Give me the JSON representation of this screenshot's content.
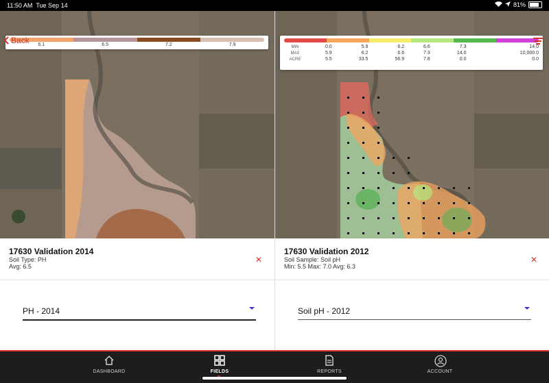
{
  "status": {
    "time": "11:50 AM",
    "date": "Tue Sep 14",
    "battery": "81%",
    "battery_level": 0.81
  },
  "nav": {
    "back_label": "Back"
  },
  "left": {
    "legend": {
      "colors": [
        "#f3a26a",
        "#b5949b",
        "#8a4a22",
        "#d7c0b1"
      ],
      "values": [
        "6.1",
        "6.5",
        "7.2",
        "7.9"
      ]
    },
    "title": "17630 Validation 2014",
    "line1": "Soil Type: PH",
    "line2": "Avg: 6.5",
    "close": "✕",
    "select_value": "PH - 2014"
  },
  "right": {
    "legend": {
      "colors": [
        "#e34b4b",
        "#f6a55a",
        "#f5ee6a",
        "#b5e87e",
        "#53b84f",
        "#d13fd8"
      ],
      "labels": [
        "MIN",
        "MAX",
        "ACRE"
      ],
      "rows": [
        [
          "0.0",
          "5.9",
          "6.2",
          "6.6",
          "7.3",
          "14.0"
        ],
        [
          "5.9",
          "6.2",
          "6.6",
          "7.3",
          "14.0",
          "10,000.0"
        ],
        [
          "5.5",
          "33.5",
          "56.9",
          "7.8",
          "0.0",
          "0.0"
        ]
      ]
    },
    "title": "17630 Validation 2012",
    "line1": "Soil Sample: Soil pH",
    "line2": "Min: 5.5 Max: 7.0 Avg: 6.3",
    "close": "✕",
    "select_value": "Soil pH - 2012"
  },
  "tabs": [
    {
      "label": "DASHBOARD",
      "icon": "home-icon"
    },
    {
      "label": "FIELDS",
      "icon": "grid-icon",
      "active": true
    },
    {
      "label": "REPORTS",
      "icon": "document-icon"
    },
    {
      "label": "ACCOUNT",
      "icon": "user-icon"
    }
  ]
}
